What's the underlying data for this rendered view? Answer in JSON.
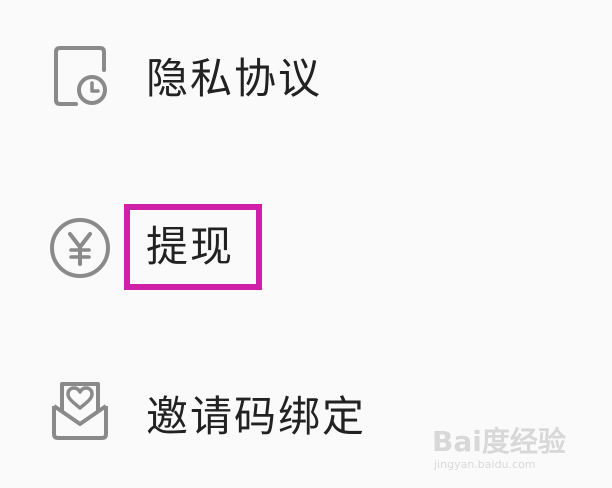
{
  "menu": {
    "items": [
      {
        "label": "隐私协议",
        "icon": "privacy-clock-icon"
      },
      {
        "label": "提现",
        "icon": "yen-circle-icon"
      },
      {
        "label": "邀请码绑定",
        "icon": "invite-envelope-heart-icon"
      }
    ]
  },
  "highlight": {
    "color": "#d020a8"
  },
  "watermark": {
    "brand": "Bai度经验",
    "url": "jingyan.baidu.com"
  }
}
